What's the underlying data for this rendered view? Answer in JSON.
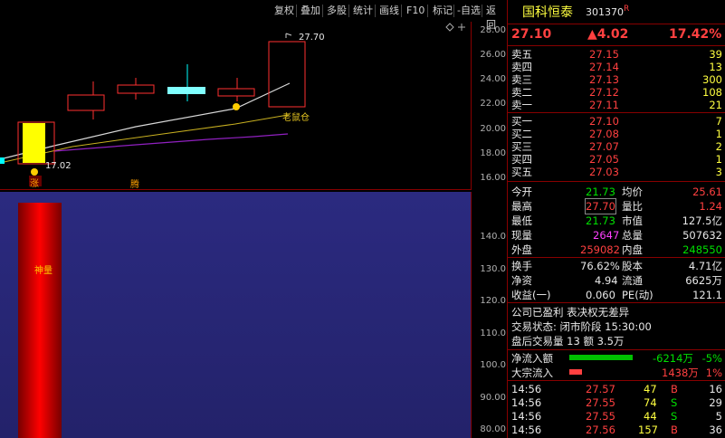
{
  "toolbar": {
    "items": [
      "复权",
      "叠加",
      "多股",
      "统计",
      "画线",
      "F10",
      "标记",
      "-自选",
      "返回"
    ]
  },
  "kchart": {
    "ticks": [
      "28.00",
      "26.00",
      "24.00",
      "22.00",
      "20.00",
      "18.00",
      "16.00"
    ],
    "high_label": "27.70",
    "low_label": "17.02",
    "ma_label": "老鼠仓",
    "mark1": "涨",
    "mark2": "腾"
  },
  "vchart": {
    "ticks": [
      "140.0",
      "130.0",
      "120.0",
      "110.0",
      "100.0",
      "90.00",
      "80.00"
    ],
    "bar_label": "神量"
  },
  "quote": {
    "name": "国科恒泰",
    "code": "301370",
    "flag": "R",
    "price": "27.10",
    "change": "▲4.02",
    "pct": "17.42%"
  },
  "asks": [
    {
      "label": "卖五",
      "price": "27.15",
      "vol": "39"
    },
    {
      "label": "卖四",
      "price": "27.14",
      "vol": "13"
    },
    {
      "label": "卖三",
      "price": "27.13",
      "vol": "300"
    },
    {
      "label": "卖二",
      "price": "27.12",
      "vol": "108"
    },
    {
      "label": "卖一",
      "price": "27.11",
      "vol": "21"
    }
  ],
  "bids": [
    {
      "label": "买一",
      "price": "27.10",
      "vol": "7"
    },
    {
      "label": "买二",
      "price": "27.08",
      "vol": "1"
    },
    {
      "label": "买三",
      "price": "27.07",
      "vol": "2"
    },
    {
      "label": "买四",
      "price": "27.05",
      "vol": "1"
    },
    {
      "label": "买五",
      "price": "27.03",
      "vol": "3"
    }
  ],
  "stats": {
    "open_l": "今开",
    "open": "21.73",
    "avg_l": "均价",
    "avg": "25.61",
    "high_l": "最高",
    "high": "27.70",
    "ratio_l": "量比",
    "ratio": "1.24",
    "low_l": "最低",
    "low": "21.73",
    "mcap_l": "市值",
    "mcap": "127.5亿",
    "cur_l": "现量",
    "cur": "2647",
    "tvol_l": "总量",
    "tvol": "507632",
    "out_l": "外盘",
    "out": "259082",
    "in_l": "内盘",
    "in": "248550",
    "turn_l": "换手",
    "turn": "76.62%",
    "cap_l": "股本",
    "cap": "4.71亿",
    "net_l": "净资",
    "net": "4.94",
    "float_l": "流通",
    "float": "6625万",
    "eps_l": "收益(一)",
    "eps": "0.060",
    "pe_l": "PE(动)",
    "pe": "121.1"
  },
  "info": {
    "line1": "公司已盈利 表决权无差异",
    "line2": "交易状态: 闭市阶段 15:30:00",
    "line3": "盘后交易量 13 额 3.5万"
  },
  "flow": [
    {
      "label": "净流入额",
      "value": "-6214万",
      "pct": "-5%",
      "fill": 0.85,
      "color": "#00c000"
    },
    {
      "label": "大宗流入",
      "value": "1438万",
      "pct": "1%",
      "fill": 0.2,
      "color": "#ff4040"
    }
  ],
  "ticks_list": [
    {
      "time": "14:56",
      "price": "27.57",
      "vol": "47",
      "side": "B",
      "num": "16"
    },
    {
      "time": "14:56",
      "price": "27.55",
      "vol": "74",
      "side": "S",
      "num": "29"
    },
    {
      "time": "14:56",
      "price": "27.55",
      "vol": "44",
      "side": "S",
      "num": "5"
    },
    {
      "time": "14:56",
      "price": "27.56",
      "vol": "157",
      "side": "B",
      "num": "36"
    }
  ]
}
